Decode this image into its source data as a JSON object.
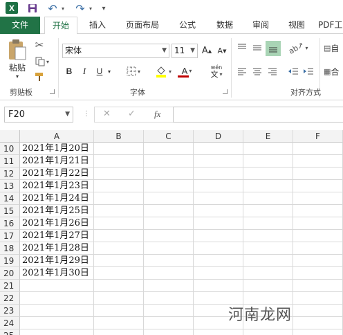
{
  "qat": {
    "logo": "X",
    "undo": "↶",
    "redo": "↷",
    "customize": "▾"
  },
  "tabs": [
    {
      "label": "文件"
    },
    {
      "label": "开始"
    },
    {
      "label": "插入"
    },
    {
      "label": "页面布局"
    },
    {
      "label": "公式"
    },
    {
      "label": "数据"
    },
    {
      "label": "审阅"
    },
    {
      "label": "视图"
    },
    {
      "label": "PDF工"
    }
  ],
  "ribbon": {
    "clipboard": {
      "paste_label": "粘贴",
      "group_label": "剪贴板"
    },
    "font": {
      "name": "宋体",
      "size": "11",
      "grow": "A",
      "shrink": "A",
      "bold": "B",
      "italic": "I",
      "underline": "U",
      "font_color_glyph": "A",
      "wen_glyph": "wén",
      "wen_char": "文",
      "group_label": "字体"
    },
    "alignment": {
      "group_label": "对齐方式",
      "extra": "自",
      "extra2": "合"
    }
  },
  "formula_bar": {
    "name_box": "F20",
    "cancel": "✕",
    "enter": "✓",
    "fx": "fx",
    "content": ""
  },
  "grid": {
    "columns": [
      "A",
      "B",
      "C",
      "D",
      "E",
      "F"
    ],
    "rows": [
      {
        "num": "10",
        "a": "2021年1月20日"
      },
      {
        "num": "11",
        "a": "2021年1月21日"
      },
      {
        "num": "12",
        "a": "2021年1月22日"
      },
      {
        "num": "13",
        "a": "2021年1月23日"
      },
      {
        "num": "14",
        "a": "2021年1月24日"
      },
      {
        "num": "15",
        "a": "2021年1月25日"
      },
      {
        "num": "16",
        "a": "2021年1月26日"
      },
      {
        "num": "17",
        "a": "2021年1月27日"
      },
      {
        "num": "18",
        "a": "2021年1月28日"
      },
      {
        "num": "19",
        "a": "2021年1月29日"
      },
      {
        "num": "20",
        "a": "2021年1月30日"
      },
      {
        "num": "21",
        "a": ""
      },
      {
        "num": "22",
        "a": ""
      },
      {
        "num": "23",
        "a": ""
      },
      {
        "num": "24",
        "a": ""
      },
      {
        "num": "25",
        "a": ""
      }
    ]
  },
  "watermark": "河南龙网",
  "colors": {
    "excel_green": "#217346",
    "highlight": "#ffff00",
    "font_red": "#c00000"
  }
}
